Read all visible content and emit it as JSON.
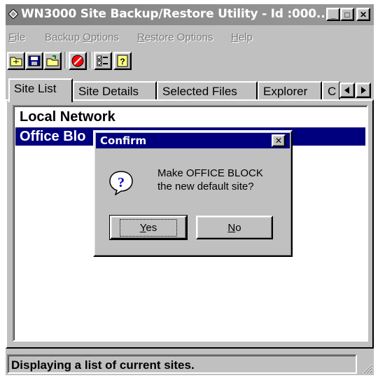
{
  "window": {
    "title": "WN3000 Site Backup/Restore Utility - Id :000...",
    "controls": {
      "minimize": "_",
      "maximize": "□",
      "close": "✕"
    }
  },
  "menu": [
    {
      "label": "File",
      "mnemonic": "F",
      "rest": "ile"
    },
    {
      "label": "Backup Options",
      "pre": "Backup ",
      "mnemonic": "O",
      "rest": "ptions"
    },
    {
      "label": "Restore Options",
      "mnemonic": "R",
      "rest": "estore Options"
    },
    {
      "label": "Help",
      "mnemonic": "H",
      "rest": "elp"
    }
  ],
  "toolbar": {
    "icons": [
      "open-site-icon",
      "save-site-icon",
      "new-site-icon",
      "stop-icon",
      "select-files-icon",
      "help-icon"
    ]
  },
  "tabs": {
    "items": [
      "Site List",
      "Site Details",
      "Selected Files",
      "Explorer",
      "C"
    ],
    "active": "Site List"
  },
  "site_list": {
    "rows": [
      {
        "label": "Local Network",
        "selected": false
      },
      {
        "label": "Office Blo",
        "selected": true
      }
    ]
  },
  "status": {
    "text": "Displaying a list of current sites."
  },
  "dialog": {
    "title": "Confirm",
    "message_line1": "Make OFFICE BLOCK",
    "message_line2": "the new default site?",
    "yes_mnemonic": "Y",
    "yes_rest": "es",
    "no_mnemonic": "N",
    "no_rest": "o",
    "close": "✕",
    "icon_glyph": "?"
  },
  "colors": {
    "selection": "#00007f",
    "face": "#c0c0c0",
    "dialog_title": "#00007f"
  }
}
